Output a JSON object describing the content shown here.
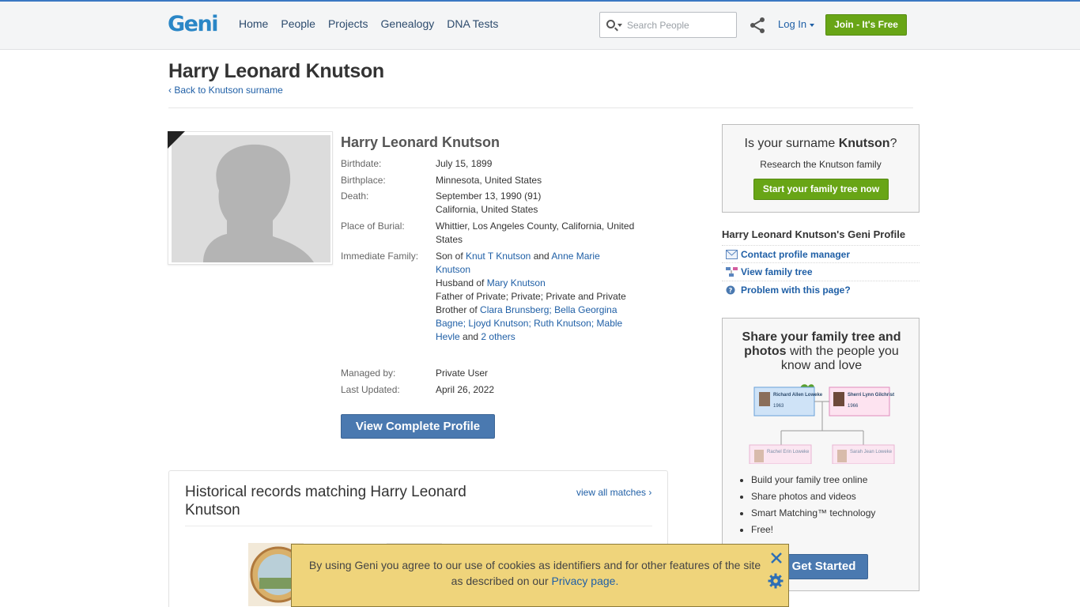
{
  "header": {
    "logo": "Geni",
    "nav": [
      "Home",
      "People",
      "Projects",
      "Genealogy",
      "DNA Tests"
    ],
    "search_placeholder": "Search People",
    "login_label": "Log In",
    "join_label": "Join - It's Free"
  },
  "page": {
    "title": "Harry Leonard Knutson",
    "back_link": "‹ Back to Knutson surname"
  },
  "profile": {
    "name": "Harry Leonard Knutson",
    "birthdate_label": "Birthdate:",
    "birthdate": "July 15, 1899",
    "birthplace_label": "Birthplace:",
    "birthplace": "Minnesota, United States",
    "death_label": "Death:",
    "death_date": "September 13, 1990 (91)",
    "death_place": "California, United States",
    "burial_label": "Place of Burial:",
    "burial": "Whittier, Los Angeles County, California, United States",
    "family_label": "Immediate Family:",
    "family": {
      "son_of": "Son of",
      "father": "Knut T Knutson",
      "and1": "and",
      "mother": "Anne Marie Knutson",
      "husband_of": "Husband of",
      "spouse": "Mary Knutson",
      "father_of": "Father of Private; Private; Private and Private",
      "brother_of": "Brother of",
      "sibling1": "Clara Brunsberg",
      "sibling2": "Bella Georgina Bagne",
      "sibling3": "Ljoyd Knutson",
      "sibling4": "Ruth Knutson",
      "sibling5": "Mable Hevle",
      "and2": "and",
      "others": "2 others"
    },
    "managed_label": "Managed by:",
    "managed_by": "Private User",
    "updated_label": "Last Updated:",
    "updated": "April 26, 2022",
    "view_button": "View Complete Profile"
  },
  "records": {
    "title": "Historical records matching Harry Leonard Knutson",
    "view_all": "view all matches ›"
  },
  "sidebar": {
    "surname_q_pre": "Is your surname",
    "surname": "Knutson",
    "surname_q_post": "?",
    "research": "Research the Knutson family",
    "start_button": "Start your family tree now",
    "geni_profile_heading": "Harry Leonard Knutson's Geni Profile",
    "links": [
      "Contact profile manager",
      "View family tree",
      "Problem with this page?"
    ],
    "share_head_bold": "Share your family tree and photos",
    "share_head_rest": "with the people you know and love",
    "tree_people": [
      {
        "name": "Richard Allen Loweke",
        "year": "1963"
      },
      {
        "name": "Sherri Lynn Gilchrist",
        "year": "1966"
      },
      {
        "name": "Rachel Erin Loweke",
        "year": ""
      },
      {
        "name": "Sarah Jean Loweke",
        "year": ""
      }
    ],
    "bullets": [
      "Build your family tree online",
      "Share photos and videos",
      "Smart Matching™ technology",
      "Free!"
    ],
    "get_started": "Get Started"
  },
  "cookie": {
    "message": "By using Geni you agree to our use of cookies as identifiers and for other features of the site as described on our",
    "privacy_link": "Privacy page."
  },
  "colors": {
    "accent_blue": "#1f5fa6",
    "green_button": "#68a516",
    "blue_button": "#4a79b0",
    "cookie_bg": "#efd47b"
  }
}
